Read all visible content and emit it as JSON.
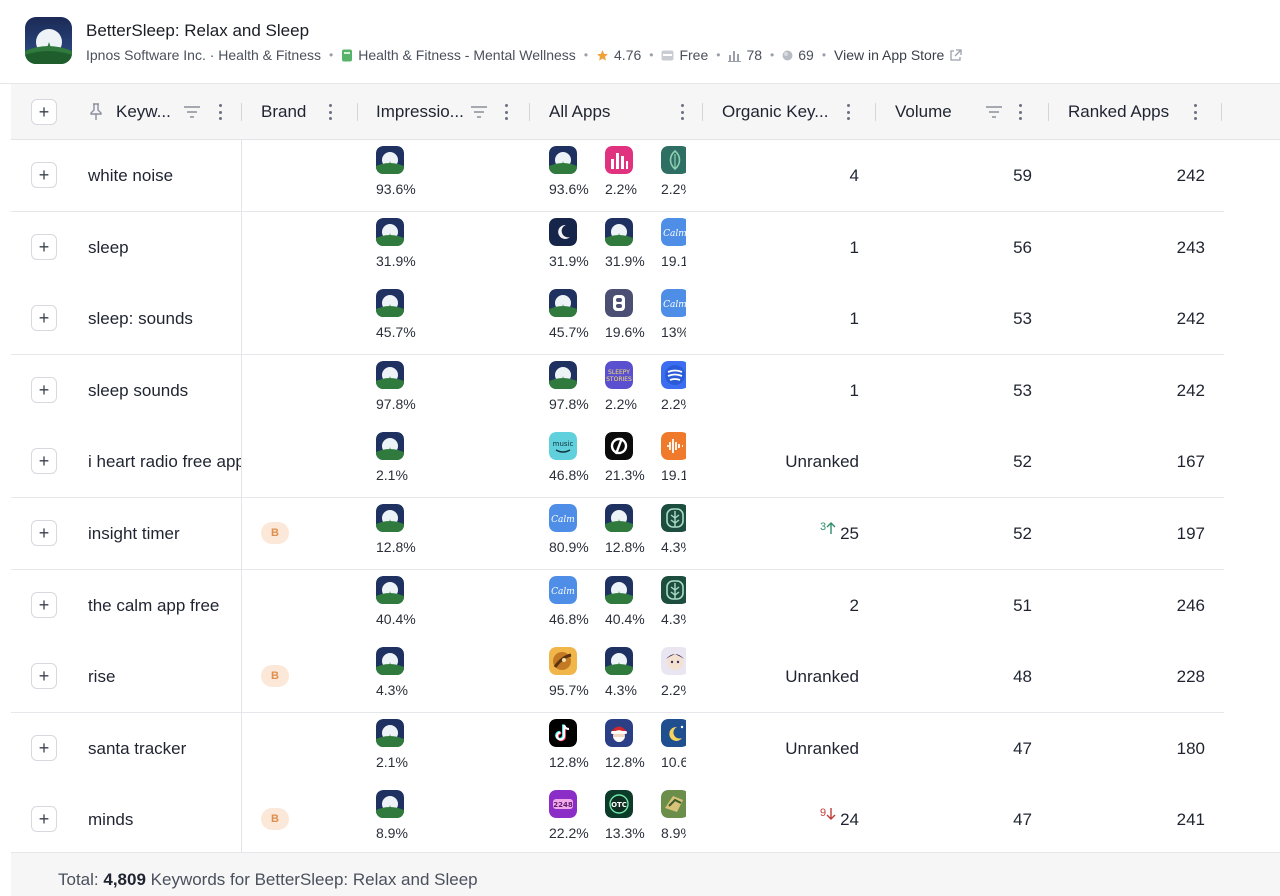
{
  "app": {
    "title": "BetterSleep: Relax and Sleep",
    "developer": "Ipnos Software Inc. · Health & Fitness",
    "category": "Health & Fitness - Mental Wellness",
    "rating": "4.76",
    "price": "Free",
    "stat1": "78",
    "stat2": "69",
    "store_link": "View in App Store"
  },
  "columns": {
    "keyword": "Keyw...",
    "brand": "Brand",
    "impressions": "Impressio...",
    "all_apps": "All Apps",
    "organic": "Organic Key...",
    "volume": "Volume",
    "ranked": "Ranked Apps"
  },
  "colors": {
    "brand_badge_bg": "#fbe8d8",
    "brand_badge_fg": "#e08e4e",
    "trend_up": "#2f8f6a",
    "trend_down": "#c23b3b"
  },
  "rows": [
    {
      "keyword": "white noise",
      "brand": "",
      "impression": "93.6%",
      "organic": "4",
      "trend": "",
      "trend_dir": "",
      "volume": "59",
      "ranked": "242",
      "apps": [
        {
          "icon": "bettersleep-icon",
          "pct": "93.6%"
        },
        {
          "icon": "equalizer-app-icon",
          "pct": "2.2%"
        },
        {
          "icon": "leaf-app-icon",
          "pct": "2.2%"
        }
      ]
    },
    {
      "keyword": "sleep",
      "brand": "",
      "impression": "31.9%",
      "organic": "1",
      "trend": "",
      "trend_dir": "",
      "volume": "56",
      "ranked": "243",
      "apps": [
        {
          "icon": "moon-app-icon",
          "pct": "31.9%"
        },
        {
          "icon": "bettersleep-icon",
          "pct": "31.9%"
        },
        {
          "icon": "calm-icon",
          "pct": "19.1"
        }
      ]
    },
    {
      "keyword": "sleep: sounds",
      "brand": "",
      "impression": "45.7%",
      "organic": "1",
      "trend": "",
      "trend_dir": "",
      "volume": "53",
      "ranked": "242",
      "apps": [
        {
          "icon": "bettersleep-icon",
          "pct": "45.7%"
        },
        {
          "icon": "b-letter-app-icon",
          "pct": "19.6%"
        },
        {
          "icon": "calm-icon",
          "pct": "13%"
        }
      ]
    },
    {
      "keyword": "sleep sounds",
      "brand": "",
      "impression": "97.8%",
      "organic": "1",
      "trend": "",
      "trend_dir": "",
      "volume": "53",
      "ranked": "242",
      "apps": [
        {
          "icon": "bettersleep-icon",
          "pct": "97.8%"
        },
        {
          "icon": "sleepy-stories-icon",
          "pct": "2.2%"
        },
        {
          "icon": "blue-wave-app-icon",
          "pct": "2.2%"
        }
      ]
    },
    {
      "keyword": "i heart radio free app",
      "brand": "",
      "impression": "2.1%",
      "organic": "Unranked",
      "trend": "",
      "trend_dir": "",
      "volume": "52",
      "ranked": "167",
      "apps": [
        {
          "icon": "amazon-music-icon",
          "pct": "46.8%"
        },
        {
          "icon": "peloton-icon",
          "pct": "21.3%"
        },
        {
          "icon": "audiomack-icon",
          "pct": "19.1"
        }
      ]
    },
    {
      "keyword": "insight timer",
      "brand": "B",
      "impression": "12.8%",
      "organic": "25",
      "trend": "3",
      "trend_dir": "up",
      "volume": "52",
      "ranked": "197",
      "apps": [
        {
          "icon": "calm-icon",
          "pct": "80.9%"
        },
        {
          "icon": "bettersleep-icon",
          "pct": "12.8%"
        },
        {
          "icon": "tree-app-icon",
          "pct": "4.3%"
        }
      ]
    },
    {
      "keyword": "the calm app free",
      "brand": "",
      "impression": "40.4%",
      "organic": "2",
      "trend": "",
      "trend_dir": "",
      "volume": "51",
      "ranked": "246",
      "apps": [
        {
          "icon": "calm-icon",
          "pct": "46.8%"
        },
        {
          "icon": "bettersleep-icon",
          "pct": "40.4%"
        },
        {
          "icon": "tree-app-icon",
          "pct": "4.3%"
        }
      ]
    },
    {
      "keyword": "rise",
      "brand": "B",
      "impression": "4.3%",
      "organic": "Unranked",
      "trend": "",
      "trend_dir": "",
      "volume": "48",
      "ranked": "228",
      "apps": [
        {
          "icon": "game-character-icon",
          "pct": "95.7%"
        },
        {
          "icon": "bettersleep-icon",
          "pct": "4.3%"
        },
        {
          "icon": "anime-game-icon",
          "pct": "2.2%"
        }
      ]
    },
    {
      "keyword": "santa tracker",
      "brand": "",
      "impression": "2.1%",
      "organic": "Unranked",
      "trend": "",
      "trend_dir": "",
      "volume": "47",
      "ranked": "180",
      "apps": [
        {
          "icon": "tiktok-icon",
          "pct": "12.8%"
        },
        {
          "icon": "santa-app-icon",
          "pct": "12.8%"
        },
        {
          "icon": "night-moon-app-icon",
          "pct": "10.6"
        }
      ]
    },
    {
      "keyword": "minds",
      "brand": "B",
      "impression": "8.9%",
      "organic": "24",
      "trend": "9",
      "trend_dir": "down",
      "volume": "47",
      "ranked": "241",
      "apps": [
        {
          "icon": "2248-game-icon",
          "pct": "22.2%"
        },
        {
          "icon": "otc-app-icon",
          "pct": "13.3%"
        },
        {
          "icon": "puzzle-game-icon",
          "pct": "8.9%"
        }
      ]
    }
  ],
  "footer": {
    "prefix": "Total:",
    "count": "4,809",
    "suffix": "Keywords for BetterSleep: Relax and Sleep"
  }
}
